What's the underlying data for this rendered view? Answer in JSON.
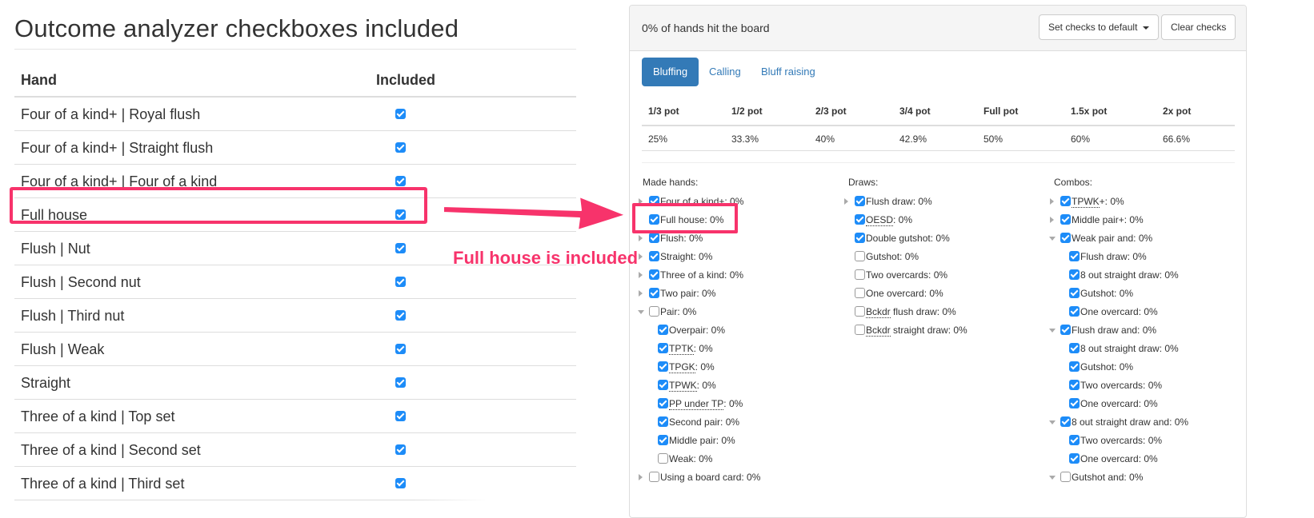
{
  "left": {
    "title": "Outcome analyzer checkboxes included",
    "headers": {
      "hand": "Hand",
      "included": "Included"
    },
    "rows": [
      {
        "hand": "Four of a kind+ | Royal flush",
        "checked": true
      },
      {
        "hand": "Four of a kind+ | Straight flush",
        "checked": true
      },
      {
        "hand": "Four of a kind+ | Four of a kind",
        "checked": true
      },
      {
        "hand": "Full house",
        "checked": true
      },
      {
        "hand": "Flush | Nut",
        "checked": true
      },
      {
        "hand": "Flush | Second nut",
        "checked": true
      },
      {
        "hand": "Flush | Third nut",
        "checked": true
      },
      {
        "hand": "Flush | Weak",
        "checked": true
      },
      {
        "hand": "Straight",
        "checked": true
      },
      {
        "hand": "Three of a kind | Top set",
        "checked": true
      },
      {
        "hand": "Three of a kind | Second set",
        "checked": true
      },
      {
        "hand": "Three of a kind | Third set",
        "checked": true
      }
    ]
  },
  "annotation": {
    "text": "Full house is included",
    "color": "#f7336b"
  },
  "panel": {
    "title": "0% of hands hit the board",
    "buttons": {
      "default": "Set checks to default",
      "clear": "Clear checks"
    },
    "tabs": [
      "Bluffing",
      "Calling",
      "Bluff raising"
    ],
    "pot_headers": [
      "1/3 pot",
      "1/2 pot",
      "2/3 pot",
      "3/4 pot",
      "Full pot",
      "1.5x pot",
      "2x pot"
    ],
    "pot_values": [
      "25%",
      "33.3%",
      "40%",
      "42.9%",
      "50%",
      "60%",
      "66.6%"
    ],
    "made_hands_label": "Made hands:",
    "draws_label": "Draws:",
    "combos_label": "Combos:",
    "made_hands": [
      {
        "label": "Four of a kind+: 0%",
        "checked": true,
        "indent": 0,
        "toggle": "right"
      },
      {
        "label": "Full house: 0%",
        "checked": true,
        "indent": 0,
        "toggle": ""
      },
      {
        "label": "Flush: 0%",
        "checked": true,
        "indent": 0,
        "toggle": "right"
      },
      {
        "label": "Straight: 0%",
        "checked": true,
        "indent": 0,
        "toggle": "right"
      },
      {
        "label": "Three of a kind: 0%",
        "checked": true,
        "indent": 0,
        "toggle": "right"
      },
      {
        "label": "Two pair: 0%",
        "checked": true,
        "indent": 0,
        "toggle": "right"
      },
      {
        "label": "Pair: 0%",
        "checked": false,
        "indent": 0,
        "toggle": "down"
      },
      {
        "label": "Overpair: 0%",
        "checked": true,
        "indent": 1,
        "toggle": ""
      },
      {
        "label": "TPTK: 0%",
        "checked": true,
        "indent": 1,
        "toggle": "",
        "abbr": "TPTK"
      },
      {
        "label": "TPGK: 0%",
        "checked": true,
        "indent": 1,
        "toggle": "",
        "abbr": "TPGK"
      },
      {
        "label": "TPWK: 0%",
        "checked": true,
        "indent": 1,
        "toggle": "",
        "abbr": "TPWK"
      },
      {
        "label": "PP under TP: 0%",
        "checked": true,
        "indent": 1,
        "toggle": "",
        "abbr": "PP under TP"
      },
      {
        "label": "Second pair: 0%",
        "checked": true,
        "indent": 1,
        "toggle": ""
      },
      {
        "label": "Middle pair: 0%",
        "checked": true,
        "indent": 1,
        "toggle": ""
      },
      {
        "label": "Weak: 0%",
        "checked": false,
        "indent": 1,
        "toggle": ""
      },
      {
        "label": "Using a board card: 0%",
        "checked": false,
        "indent": 0,
        "toggle": "right"
      }
    ],
    "draws": [
      {
        "label": "Flush draw: 0%",
        "checked": true,
        "indent": 0,
        "toggle": "right"
      },
      {
        "label": "OESD: 0%",
        "checked": true,
        "indent": 0,
        "toggle": "",
        "abbr": "OESD"
      },
      {
        "label": "Double gutshot: 0%",
        "checked": true,
        "indent": 0,
        "toggle": ""
      },
      {
        "label": "Gutshot: 0%",
        "checked": false,
        "indent": 0,
        "toggle": ""
      },
      {
        "label": "Two overcards: 0%",
        "checked": false,
        "indent": 0,
        "toggle": ""
      },
      {
        "label": "One overcard: 0%",
        "checked": false,
        "indent": 0,
        "toggle": ""
      },
      {
        "label": "Bckdr flush draw: 0%",
        "checked": false,
        "indent": 0,
        "toggle": "",
        "abbr": "Bckdr"
      },
      {
        "label": "Bckdr straight draw: 0%",
        "checked": false,
        "indent": 0,
        "toggle": "",
        "abbr": "Bckdr"
      }
    ],
    "combos": [
      {
        "label": "TPWK+: 0%",
        "checked": true,
        "indent": 0,
        "toggle": "right",
        "abbr": "TPWK"
      },
      {
        "label": "Middle pair+: 0%",
        "checked": true,
        "indent": 0,
        "toggle": "right"
      },
      {
        "label": "Weak pair and: 0%",
        "checked": true,
        "indent": 0,
        "toggle": "down"
      },
      {
        "label": "Flush draw: 0%",
        "checked": true,
        "indent": 1,
        "toggle": ""
      },
      {
        "label": "8 out straight draw: 0%",
        "checked": true,
        "indent": 1,
        "toggle": ""
      },
      {
        "label": "Gutshot: 0%",
        "checked": true,
        "indent": 1,
        "toggle": ""
      },
      {
        "label": "One overcard: 0%",
        "checked": true,
        "indent": 1,
        "toggle": ""
      },
      {
        "label": "Flush draw and: 0%",
        "checked": true,
        "indent": 0,
        "toggle": "down"
      },
      {
        "label": "8 out straight draw: 0%",
        "checked": true,
        "indent": 1,
        "toggle": ""
      },
      {
        "label": "Gutshot: 0%",
        "checked": true,
        "indent": 1,
        "toggle": ""
      },
      {
        "label": "Two overcards: 0%",
        "checked": true,
        "indent": 1,
        "toggle": ""
      },
      {
        "label": "One overcard: 0%",
        "checked": true,
        "indent": 1,
        "toggle": ""
      },
      {
        "label": "8 out straight draw and: 0%",
        "checked": true,
        "indent": 0,
        "toggle": "down"
      },
      {
        "label": "Two overcards: 0%",
        "checked": true,
        "indent": 1,
        "toggle": ""
      },
      {
        "label": "One overcard: 0%",
        "checked": true,
        "indent": 1,
        "toggle": ""
      },
      {
        "label": "Gutshot and: 0%",
        "checked": false,
        "indent": 0,
        "toggle": "down"
      }
    ]
  }
}
